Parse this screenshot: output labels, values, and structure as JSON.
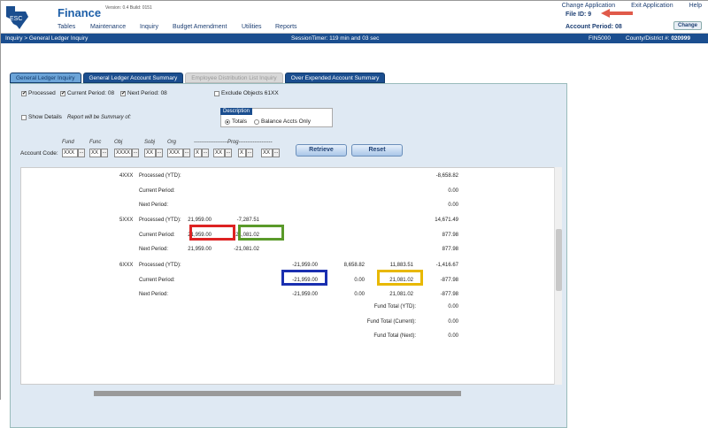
{
  "header": {
    "app_title": "Finance",
    "version": "Version: 0.4  Build: 0151",
    "menu": [
      "Tables",
      "Maintenance",
      "Inquiry",
      "Budget Amendment",
      "Utilities",
      "Reports"
    ],
    "links": [
      "Change Application",
      "Exit Application",
      "Help"
    ],
    "file_id": "File ID: 9",
    "account_period": "Account Period: 08",
    "change_label": "Change"
  },
  "navbar": {
    "breadcrumb": "Inquiry > General Ledger Inquiry",
    "session": "SessionTimer: 119 min and 03 sec",
    "fin_code": "FIN5000",
    "county_label": "County/District #:",
    "county_value": "020999"
  },
  "tabs": [
    "General Ledger Inquiry",
    "General Ledger Account Summary",
    "Employee Distribution List Inquiry",
    "Over Expended Account Summary"
  ],
  "options": {
    "processed": "Processed",
    "current_period": "Current Period: 08",
    "next_period": "Next Period: 08",
    "exclude": "Exclude Objects 61XX",
    "show_details": "Show Details",
    "summary_note": "Report will be Summary of:",
    "description": "Description",
    "totals": "Totals",
    "balance_only": "Balance Accts Only"
  },
  "account_code": {
    "label": "Account Code:",
    "headers": [
      "Fund",
      "Func",
      "Obj",
      "Sobj",
      "Org",
      "-------------------Prog-------------------"
    ],
    "fields": [
      "XXX",
      "XX",
      "XXXX",
      "XX",
      "XXX",
      "X",
      "XX",
      "X",
      "XX"
    ],
    "dots": "...",
    "retrieve": "Retrieve",
    "reset": "Reset"
  },
  "report": {
    "groups": [
      {
        "code": "4XXX",
        "rows": [
          {
            "label": "Processed (YTD):",
            "c1": "",
            "c2": "",
            "c3": "",
            "c4": "",
            "c5": "",
            "c6": "-8,658.82"
          },
          {
            "label": "Current Period:",
            "c1": "",
            "c2": "",
            "c3": "",
            "c4": "",
            "c5": "",
            "c6": "0.00"
          },
          {
            "label": "Next Period:",
            "c1": "",
            "c2": "",
            "c3": "",
            "c4": "",
            "c5": "",
            "c6": "0.00"
          }
        ]
      },
      {
        "code": "5XXX",
        "rows": [
          {
            "label": "Processed (YTD):",
            "c1": "21,959.00",
            "c2": "-7,287.51",
            "c3": "",
            "c4": "",
            "c5": "",
            "c6": "14,671.49"
          },
          {
            "label": "Current Period:",
            "c1": "21,959.00",
            "c2": "-21,081.02",
            "c3": "",
            "c4": "",
            "c5": "",
            "c6": "877.98"
          },
          {
            "label": "Next Period:",
            "c1": "21,959.00",
            "c2": "-21,081.02",
            "c3": "",
            "c4": "",
            "c5": "",
            "c6": "877.98"
          }
        ]
      },
      {
        "code": "6XXX",
        "rows": [
          {
            "label": "Processed (YTD):",
            "c1": "",
            "c2": "",
            "c3": "-21,959.00",
            "c4": "8,658.82",
            "c5": "11,883.51",
            "c6": "-1,416.67"
          },
          {
            "label": "Current Period:",
            "c1": "",
            "c2": "",
            "c3": "-21,959.00",
            "c4": "0.00",
            "c5": "21,081.02",
            "c6": "-877.98"
          },
          {
            "label": "Next Period:",
            "c1": "",
            "c2": "",
            "c3": "-21,959.00",
            "c4": "0.00",
            "c5": "21,081.02",
            "c6": "-877.98"
          }
        ]
      }
    ],
    "totals": [
      {
        "label": "Fund Total (YTD):",
        "value": "0.00"
      },
      {
        "label": "Fund Total (Current):",
        "value": "0.00"
      },
      {
        "label": "Fund Total (Next):",
        "value": "0.00"
      }
    ]
  },
  "highlights": {
    "red": "#d22",
    "green": "#5a9a2a",
    "blue": "#1a2fb0",
    "yellow": "#e8b800"
  }
}
